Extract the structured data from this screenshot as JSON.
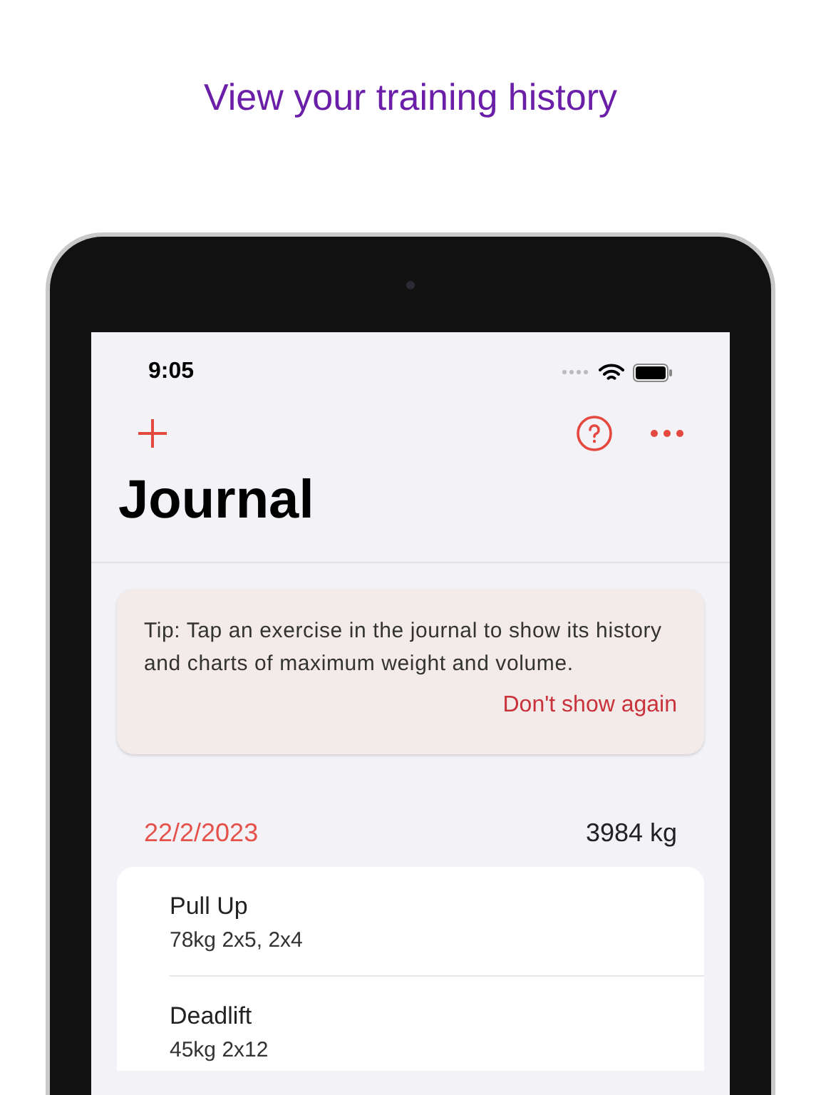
{
  "headline": "View your training history",
  "status_bar": {
    "time": "9:05"
  },
  "title": "Journal",
  "tip": {
    "text": "Tip: Tap an exercise in the journal to show its history and charts of maximum weight and volume.",
    "action": "Don't show again"
  },
  "days": [
    {
      "date": "22/2/2023",
      "total": "3984 kg",
      "exercises": [
        {
          "name": "Pull Up",
          "sets": "78kg 2x5, 2x4"
        },
        {
          "name": "Deadlift",
          "sets": "45kg 2x12"
        }
      ]
    }
  ]
}
